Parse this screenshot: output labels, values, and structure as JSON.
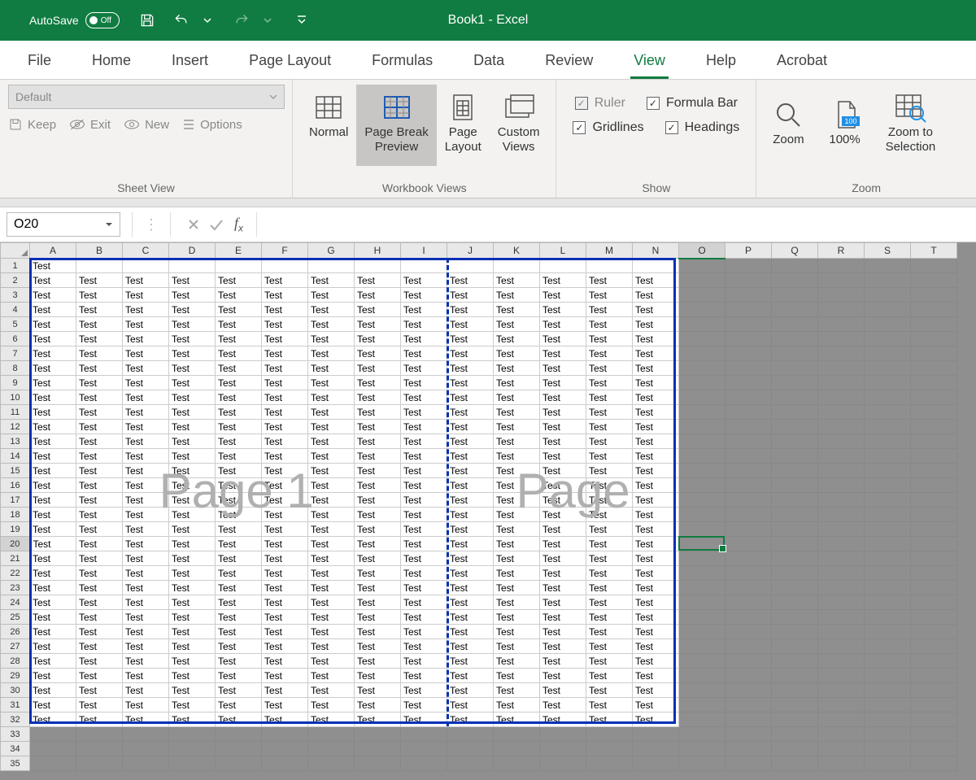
{
  "titlebar": {
    "autosave_label": "AutoSave",
    "autosave_state": "Off",
    "doc_title": "Book1 - Excel"
  },
  "tabs": [
    "File",
    "Home",
    "Insert",
    "Page Layout",
    "Formulas",
    "Data",
    "Review",
    "View",
    "Help",
    "Acrobat"
  ],
  "active_tab": "View",
  "ribbon": {
    "sheetview": {
      "label": "Sheet View",
      "dropdown": "Default",
      "items": {
        "keep": "Keep",
        "exit": "Exit",
        "new": "New",
        "options": "Options"
      }
    },
    "workbook_views": {
      "label": "Workbook Views",
      "normal": "Normal",
      "page_break": "Page Break\nPreview",
      "page_layout": "Page\nLayout",
      "custom_views": "Custom\nViews"
    },
    "show": {
      "label": "Show",
      "ruler": "Ruler",
      "formula_bar": "Formula Bar",
      "gridlines": "Gridlines",
      "headings": "Headings"
    },
    "zoom": {
      "label": "Zoom",
      "zoom": "Zoom",
      "hundred": "100%",
      "zoom_sel": "Zoom to\nSelection"
    }
  },
  "namebox": "O20",
  "columns": [
    "A",
    "B",
    "C",
    "D",
    "E",
    "F",
    "G",
    "H",
    "I",
    "J",
    "K",
    "L",
    "M",
    "N",
    "O",
    "P",
    "Q",
    "R",
    "S",
    "T"
  ],
  "rows": 35,
  "cell_value": "Test",
  "data_cols": 14,
  "data_rows": 32,
  "watermark1": "Page 1",
  "watermark2": "Page",
  "selected_cell": {
    "row": 20,
    "col": 15
  }
}
